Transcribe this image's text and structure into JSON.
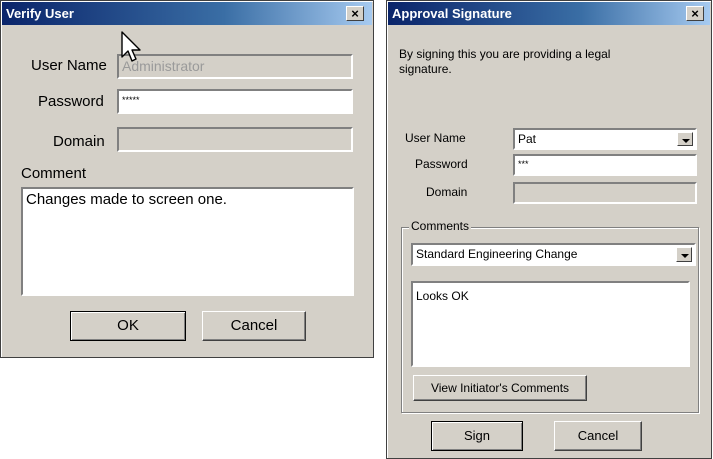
{
  "verify": {
    "title": "Verify User",
    "close_glyph": "×",
    "username_label": "User Name",
    "username_value": "Administrator",
    "password_label": "Password",
    "password_value": "*****",
    "domain_label": "Domain",
    "domain_value": "",
    "comment_label": "Comment",
    "comment_value": "Changes made to screen one.",
    "ok_label": "OK",
    "cancel_label": "Cancel"
  },
  "approval": {
    "title": "Approval Signature",
    "close_glyph": "×",
    "notice": "By signing this you are providing a legal signature.",
    "username_label": "User Name",
    "username_value": "Pat",
    "password_label": "Password",
    "password_value": "***",
    "domain_label": "Domain",
    "domain_value": "",
    "comments_group_label": "Comments",
    "comment_type_value": "Standard Engineering Change",
    "comment_text": "Looks OK",
    "view_initiator_label": "View Initiator's Comments",
    "sign_label": "Sign",
    "cancel_label": "Cancel"
  },
  "icons": {
    "cursor": "mouse-pointer-icon",
    "dropdown": "chevron-down-icon"
  }
}
